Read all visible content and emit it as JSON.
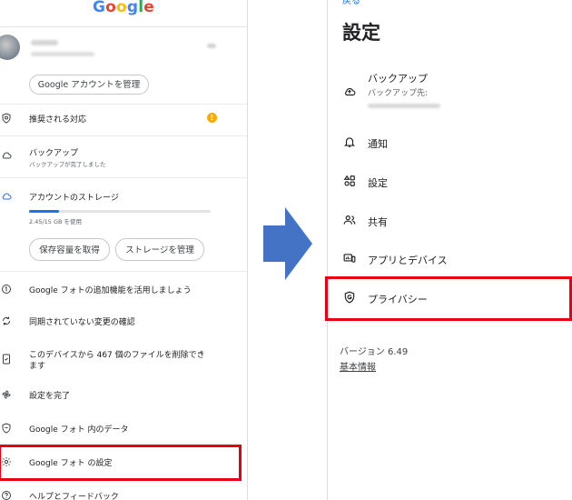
{
  "left_panel": {
    "logo": "Google",
    "manage_account_button": "Google アカウントを管理",
    "items": {
      "recommended": "推奨される対応",
      "backup": "バックアップ",
      "backup_status": "バックアップが完了しました",
      "storage": "アカウントのストレージ",
      "storage_usage": "2.45/15 GB を使用",
      "get_storage_button": "保存容量を取得",
      "manage_storage_button": "ストレージを管理",
      "extra_features": "Google フォトの追加機能を活用しましょう",
      "unsynced": "同期されていない変更の確認",
      "delete_files_line1": "このデバイスから 467 個のファイルを削除でき",
      "delete_files_line2": "ます",
      "finish_setup": "設定を完了",
      "data_in_photos": "Google フォト 内のデータ",
      "photos_settings": "Google フォト の設定",
      "help_feedback": "ヘルプとフィードバック"
    },
    "storage_fraction": 0.163
  },
  "right_panel": {
    "back": "戻る",
    "title": "設定",
    "items": {
      "backup": "バックアップ",
      "backup_dest": "バックアップ先:",
      "notifications": "通知",
      "settings": "設定",
      "sharing": "共有",
      "apps_devices": "アプリとデバイス",
      "privacy": "プライバシー"
    },
    "version": "バージョン 6.49",
    "basic_info": "基本情報"
  },
  "colors": {
    "highlight": "#e60012",
    "arrow": "#4472c4",
    "accent": "#1a73e8",
    "warning": "#f9ab00"
  },
  "icons": {
    "recommended": "shield-icon",
    "backup": "cloud-icon",
    "storage": "cloud-outline-icon",
    "extra_features": "one-icon",
    "unsynced": "sync-icon",
    "delete_files": "phone-clean-icon",
    "finish_setup": "pinwheel-icon",
    "data_in_photos": "shield-icon",
    "photos_settings": "gear-icon",
    "help_feedback": "help-icon",
    "notifications": "bell-icon",
    "settings": "shapes-icon",
    "sharing": "people-icon",
    "apps_devices": "devices-icon",
    "privacy": "google-shield-icon"
  }
}
